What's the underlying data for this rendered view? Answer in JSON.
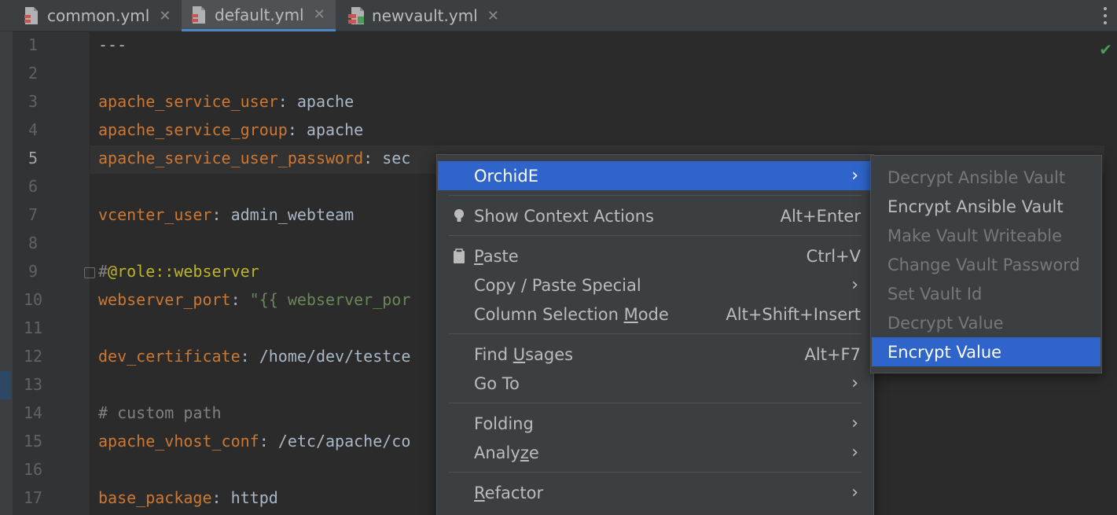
{
  "tabs": [
    {
      "label": "common.yml",
      "icon": "yaml-file-icon",
      "active": false
    },
    {
      "label": "default.yml",
      "icon": "yaml-file-icon",
      "active": true
    },
    {
      "label": "newvault.yml",
      "icon": "vault-file-icon",
      "active": false
    }
  ],
  "close_glyph": "✕",
  "line_numbers": [
    "1",
    "2",
    "3",
    "4",
    "5",
    "6",
    "7",
    "8",
    "9",
    "10",
    "11",
    "12",
    "13",
    "14",
    "15",
    "16",
    "17"
  ],
  "code": {
    "l1": "---",
    "l3_key": "apache_service_user",
    "l3_val": " apache",
    "l4_key": "apache_service_group",
    "l4_val": " apache",
    "l5_key": "apache_service_user_password",
    "l5_val": " sec",
    "l7_key": "vcenter_user",
    "l7_val": " admin_webteam",
    "l9_hash": "#",
    "l9_role": "@role::webserver",
    "l10_key": "webserver_port",
    "l10_q": " \"",
    "l10_val": "{{ webserver_por",
    "l12_key": "dev_certificate",
    "l12_val": " /home/dev/testce",
    "l14": "# custom path",
    "l15_key": "apache_vhost_conf",
    "l15_val": " /etc/apache/co",
    "l17_key": "base_package",
    "l17_val": " httpd",
    "colon": ":"
  },
  "context_menu": {
    "orchide": "OrchidE",
    "show_context_actions": "Show Context Actions",
    "show_context_actions_shortcut": "Alt+Enter",
    "paste_u": "P",
    "paste_rest": "aste",
    "paste_shortcut": "Ctrl+V",
    "copy_paste_special": "Copy / Paste Special",
    "column_selection_a": "Column Selection ",
    "column_selection_u": "M",
    "column_selection_b": "ode",
    "column_selection_shortcut": "Alt+Shift+Insert",
    "find_usages_a": "Find ",
    "find_usages_u": "U",
    "find_usages_b": "sages",
    "find_usages_shortcut": "Alt+F7",
    "go_to": "Go To",
    "folding": "Folding",
    "analyze_a": "Analy",
    "analyze_u": "z",
    "analyze_b": "e",
    "refactor_u": "R",
    "refactor_rest": "efactor",
    "arrow": "›"
  },
  "submenu": {
    "items": [
      {
        "label": "Decrypt Ansible Vault",
        "enabled": false
      },
      {
        "label": "Encrypt Ansible Vault",
        "enabled": true
      },
      {
        "label": "Make Vault Writeable",
        "enabled": false
      },
      {
        "label": "Change Vault Password",
        "enabled": false
      },
      {
        "label": "Set Vault Id",
        "enabled": false
      },
      {
        "label": "Decrypt Value",
        "enabled": false
      },
      {
        "label": "Encrypt Value",
        "enabled": true,
        "selected": true
      }
    ]
  },
  "colors": {
    "accent": "#2f65ca",
    "key": "#cc7832",
    "comment": "#808080",
    "string": "#6a8759",
    "annotation": "#bbb529"
  }
}
